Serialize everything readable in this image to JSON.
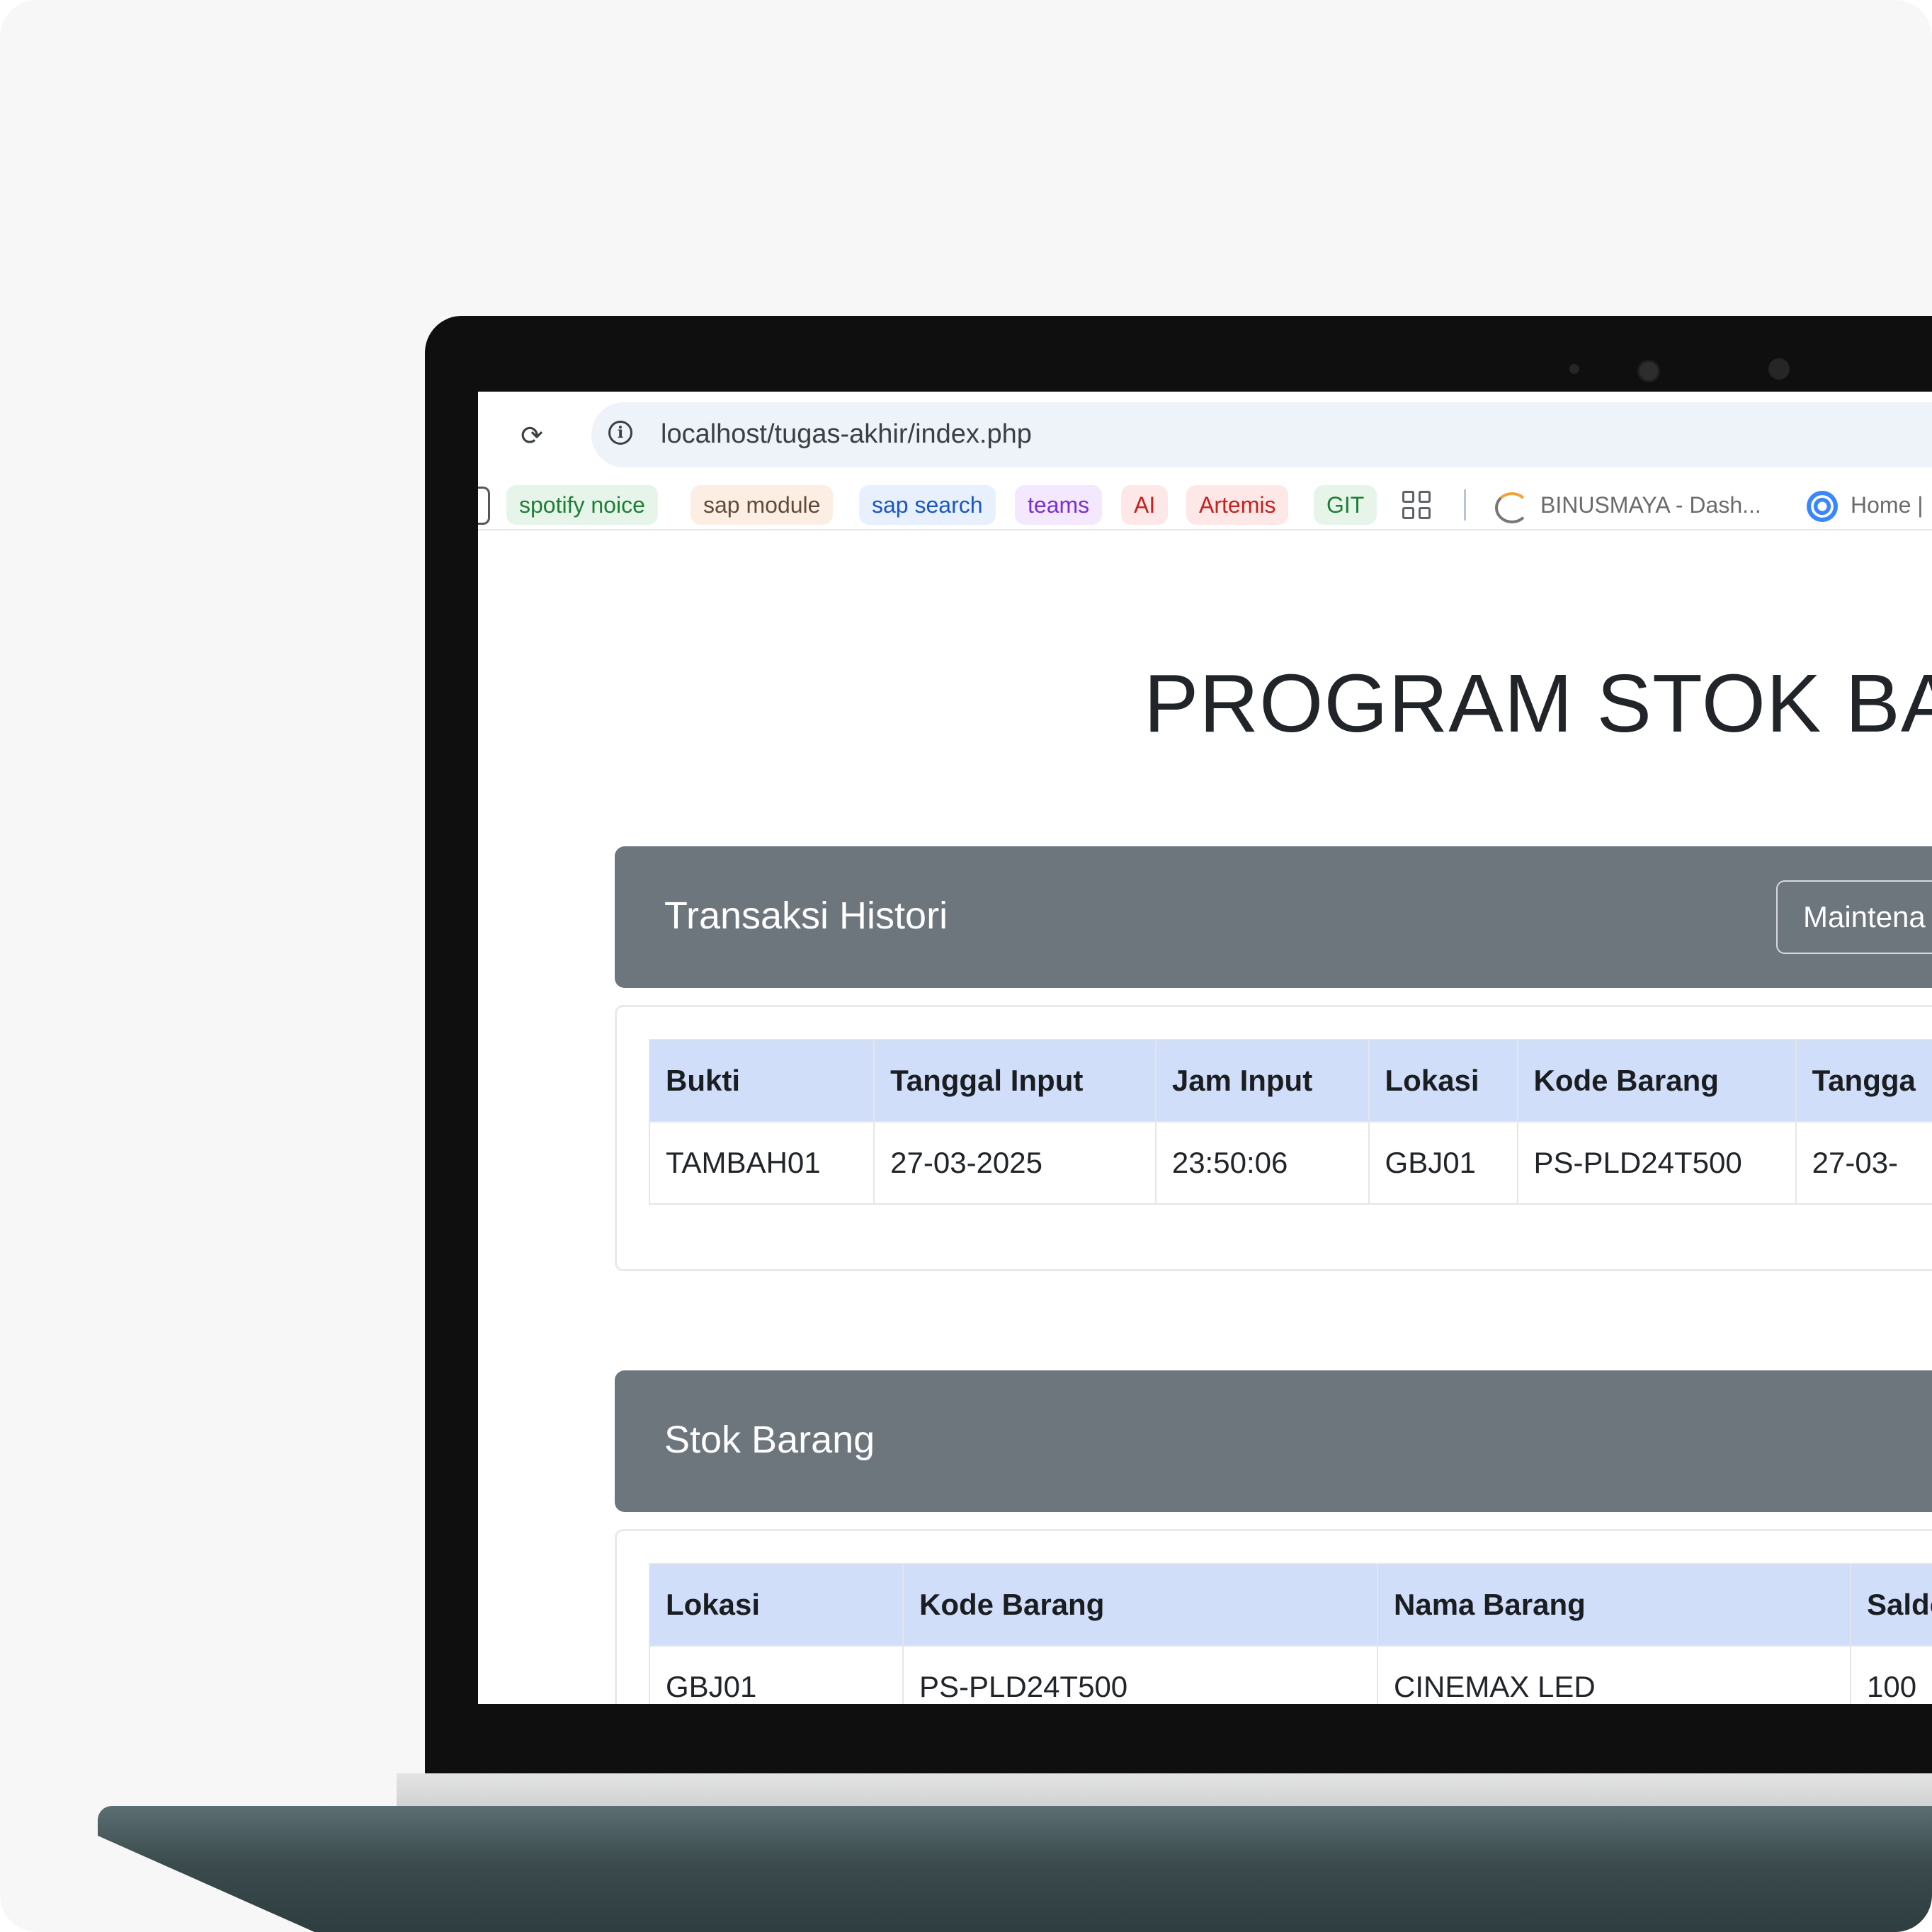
{
  "browser": {
    "url": "localhost/tugas-akhir/index.php",
    "reload_icon": "reload-icon",
    "info_icon": "info-icon",
    "bookmarks": [
      {
        "label": "spotify noice",
        "bg": "#e6f4ea",
        "color": "#1e7e34"
      },
      {
        "label": "sap module",
        "bg": "#fdeee3",
        "color": "#5f4b3a"
      },
      {
        "label": "sap search",
        "bg": "#e8f0fe",
        "color": "#1a56c4"
      },
      {
        "label": "teams",
        "bg": "#f3e8fd",
        "color": "#7b2fd1"
      },
      {
        "label": "AI",
        "bg": "#fde7e7",
        "color": "#c5221f"
      },
      {
        "label": "Artemis",
        "bg": "#fde7e7",
        "color": "#c5221f"
      },
      {
        "label": "GIT",
        "bg": "#e6f4ea",
        "color": "#1e7e34"
      }
    ],
    "bookmark_links": [
      "BINUSMAYA - Dash...",
      "Home |"
    ]
  },
  "page": {
    "title": "PROGRAM STOK BAR",
    "transaksi": {
      "title": "Transaksi Histori",
      "maintenance_label": "Maintena",
      "columns": [
        "Bukti",
        "Tanggal Input",
        "Jam Input",
        "Lokasi",
        "Kode Barang",
        "Tangga"
      ],
      "rows": [
        [
          "TAMBAH01",
          "27-03-2025",
          "23:50:06",
          "GBJ01",
          "PS-PLD24T500",
          "27-03-"
        ]
      ]
    },
    "stok": {
      "title": "Stok Barang",
      "columns": [
        "Lokasi",
        "Kode Barang",
        "Nama Barang",
        "Saldo"
      ],
      "rows": [
        [
          "GBJ01",
          "PS-PLD24T500",
          "CINEMAX LED",
          "100"
        ]
      ]
    }
  },
  "colors": {
    "card_header": "#6d757d",
    "table_header": "#d0defa",
    "laptop_bezel": "#0f0f0f"
  }
}
